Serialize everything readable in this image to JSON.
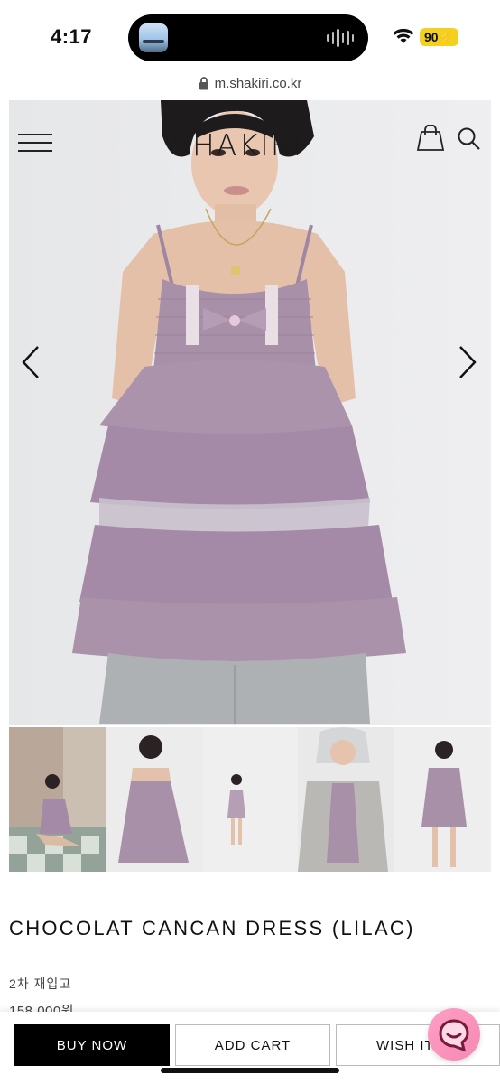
{
  "status_bar": {
    "time": "4:17",
    "battery": "90"
  },
  "browser": {
    "url": "m.shakiri.co.kr"
  },
  "header": {
    "logo": "SHAKIRI"
  },
  "product": {
    "title": "CHOCOLAT CANCAN DRESS (LILAC)",
    "restock": "2차 재입고",
    "price": "158,000원"
  },
  "actions": {
    "buy_now": "BUY NOW",
    "add_cart": "ADD CART",
    "wish": "WISH IT"
  },
  "colors": {
    "accent": "#000000",
    "lilac": "#a48aa6",
    "chat": "#f48bb5"
  },
  "icons": [
    "hamburger-icon",
    "shopping-bag-icon",
    "search-icon",
    "chevron-left-icon",
    "chevron-right-icon",
    "chat-icon",
    "lock-icon",
    "wifi-icon"
  ]
}
